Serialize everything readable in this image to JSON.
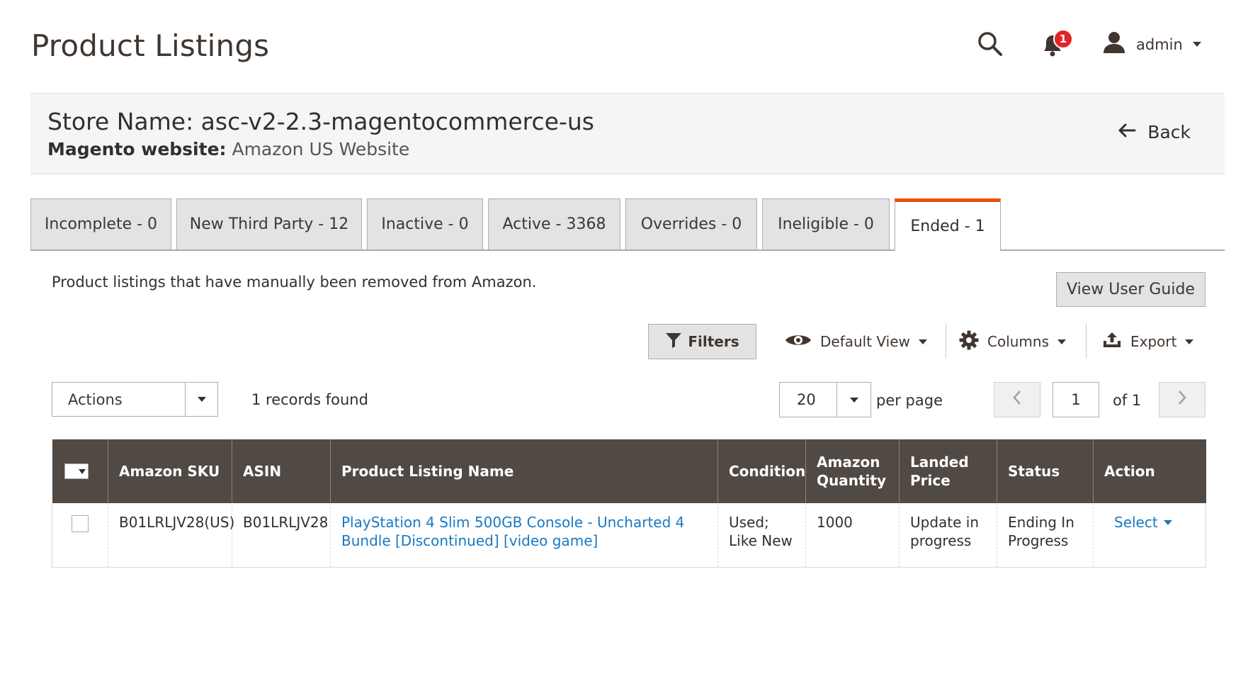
{
  "header": {
    "title": "Product Listings",
    "notifications_count": "1",
    "user_name": "admin",
    "icons": [
      "search-icon",
      "bell-icon",
      "user-icon"
    ]
  },
  "store": {
    "name": "Store Name: asc-v2-2.3-magentocommerce-us",
    "website_label": "Magento website:",
    "website_value": " Amazon US Website",
    "back_label": "Back"
  },
  "tabs": [
    {
      "label": "Incomplete - 0",
      "active": false
    },
    {
      "label": "New Third Party - 12",
      "active": false
    },
    {
      "label": "Inactive - 0",
      "active": false
    },
    {
      "label": "Active - 3368",
      "active": false
    },
    {
      "label": "Overrides - 0",
      "active": false
    },
    {
      "label": "Ineligible - 0",
      "active": false
    },
    {
      "label": "Ended - 1",
      "active": true
    }
  ],
  "description": "Product listings that have manually been removed from Amazon.",
  "guide_button": "View User Guide",
  "toolbar": {
    "filters": "Filters",
    "view": "Default View",
    "columns": "Columns",
    "export": "Export"
  },
  "mass_actions": {
    "label": "Actions",
    "records_found": "1 records found"
  },
  "pager": {
    "per_page_value": "20",
    "per_page_label": "per page",
    "current_page": "1",
    "of_label": "of 1"
  },
  "grid": {
    "columns": [
      "Amazon SKU",
      "ASIN",
      "Product Listing Name",
      "Condition",
      "Amazon Quantity",
      "Landed Price",
      "Status",
      "Action"
    ],
    "rows": [
      {
        "sku": "B01LRLJV28(US)",
        "asin": "B01LRLJV28",
        "name": "PlayStation 4 Slim 500GB Console - Uncharted 4 Bundle [Discontinued] [video game]",
        "condition": "Used; Like New",
        "quantity": "1000",
        "landed_price": "Update in progress",
        "status": "Ending In Progress",
        "action": "Select"
      }
    ]
  },
  "colors": {
    "accent": "#eb5202",
    "header_bg": "#514943",
    "link": "#1979c3",
    "badge": "#e22626"
  }
}
